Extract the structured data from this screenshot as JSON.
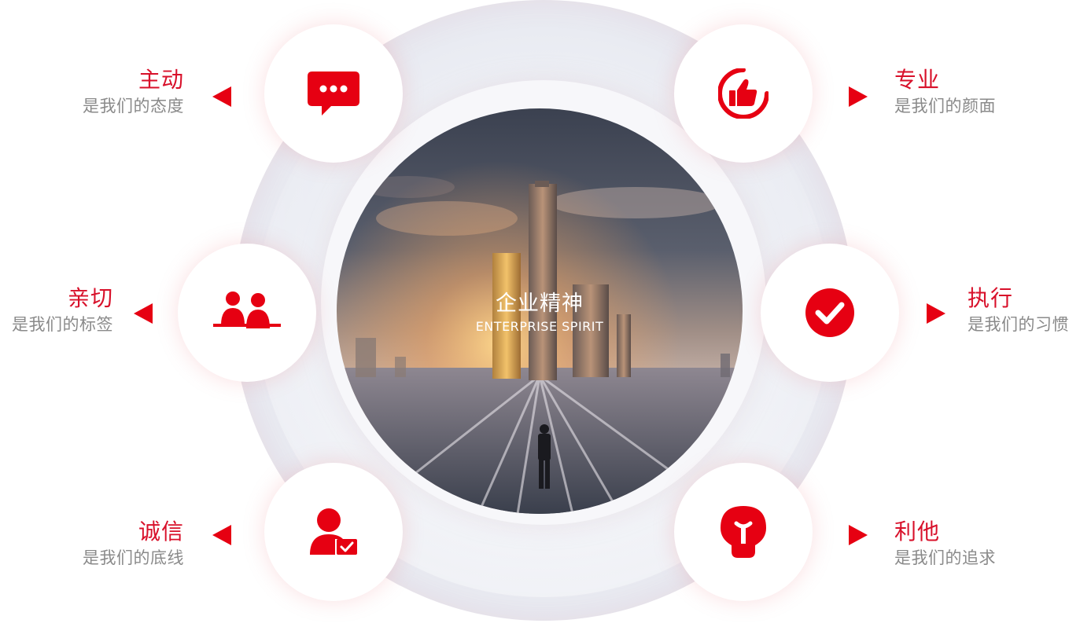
{
  "center": {
    "title": "企业精神",
    "subtitle": "ENTERPRISE SPIRIT"
  },
  "values": [
    {
      "title": "主动",
      "desc": "是我们的态度",
      "icon": "chat-bubble-icon"
    },
    {
      "title": "专业",
      "desc": "是我们的颜面",
      "icon": "thumbs-up-icon"
    },
    {
      "title": "亲切",
      "desc": "是我们的标签",
      "icon": "people-icon"
    },
    {
      "title": "执行",
      "desc": "是我们的习惯",
      "icon": "check-circle-icon"
    },
    {
      "title": "诚信",
      "desc": "是我们的底线",
      "icon": "user-check-icon"
    },
    {
      "title": "利他",
      "desc": "是我们的追求",
      "icon": "lightbulb-icon"
    }
  ],
  "colors": {
    "accent": "#e60012",
    "title_red": "#d8102a",
    "desc_gray": "#8a8a8a",
    "ring": "#eceef4"
  }
}
